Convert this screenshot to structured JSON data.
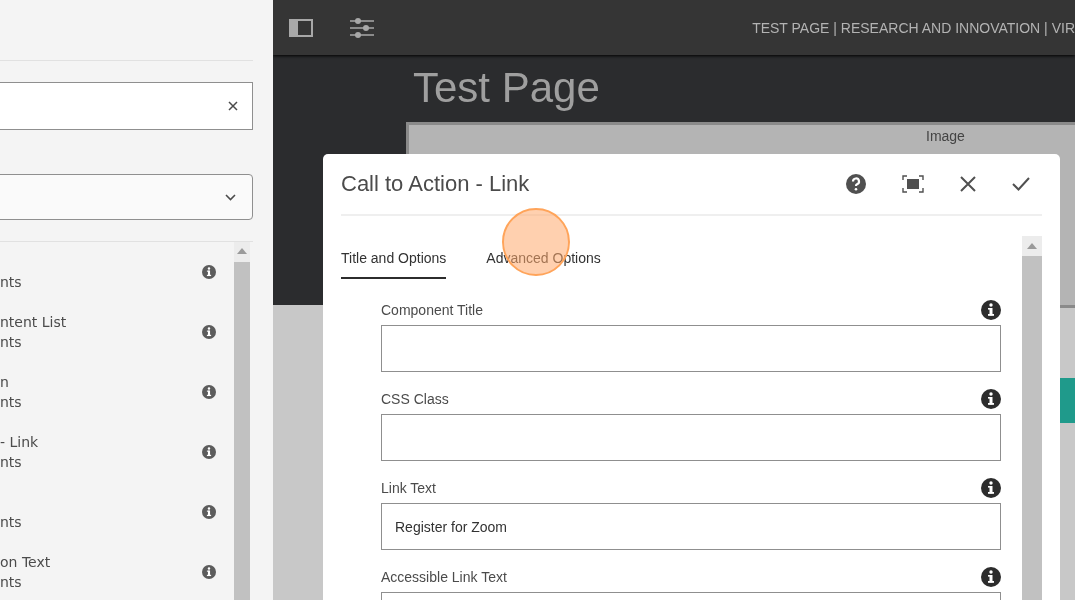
{
  "sidebar": {
    "items": [
      {
        "group": "nts"
      },
      {
        "title": "ntent List",
        "group": "nts"
      },
      {
        "title": "n",
        "group": "nts"
      },
      {
        "title": "- Link",
        "group": "nts"
      },
      {
        "group": "nts"
      },
      {
        "title": "on Text",
        "group": "nts"
      }
    ]
  },
  "topbar": {
    "page_title": "TEST PAGE | RESEARCH AND INNOVATION | VIR"
  },
  "canvas": {
    "heading": "Test Page",
    "image_label": "Image"
  },
  "dialog": {
    "title": "Call to Action - Link",
    "tabs": [
      {
        "label": "Title and Options",
        "selected": true
      },
      {
        "label": "Advanced Options",
        "selected": false
      }
    ],
    "fields": [
      {
        "label": "Component Title"
      },
      {
        "label": "CSS Class"
      },
      {
        "label": "Link Text",
        "value": "Register for Zoom"
      },
      {
        "label": "Accessible Link Text"
      }
    ]
  }
}
